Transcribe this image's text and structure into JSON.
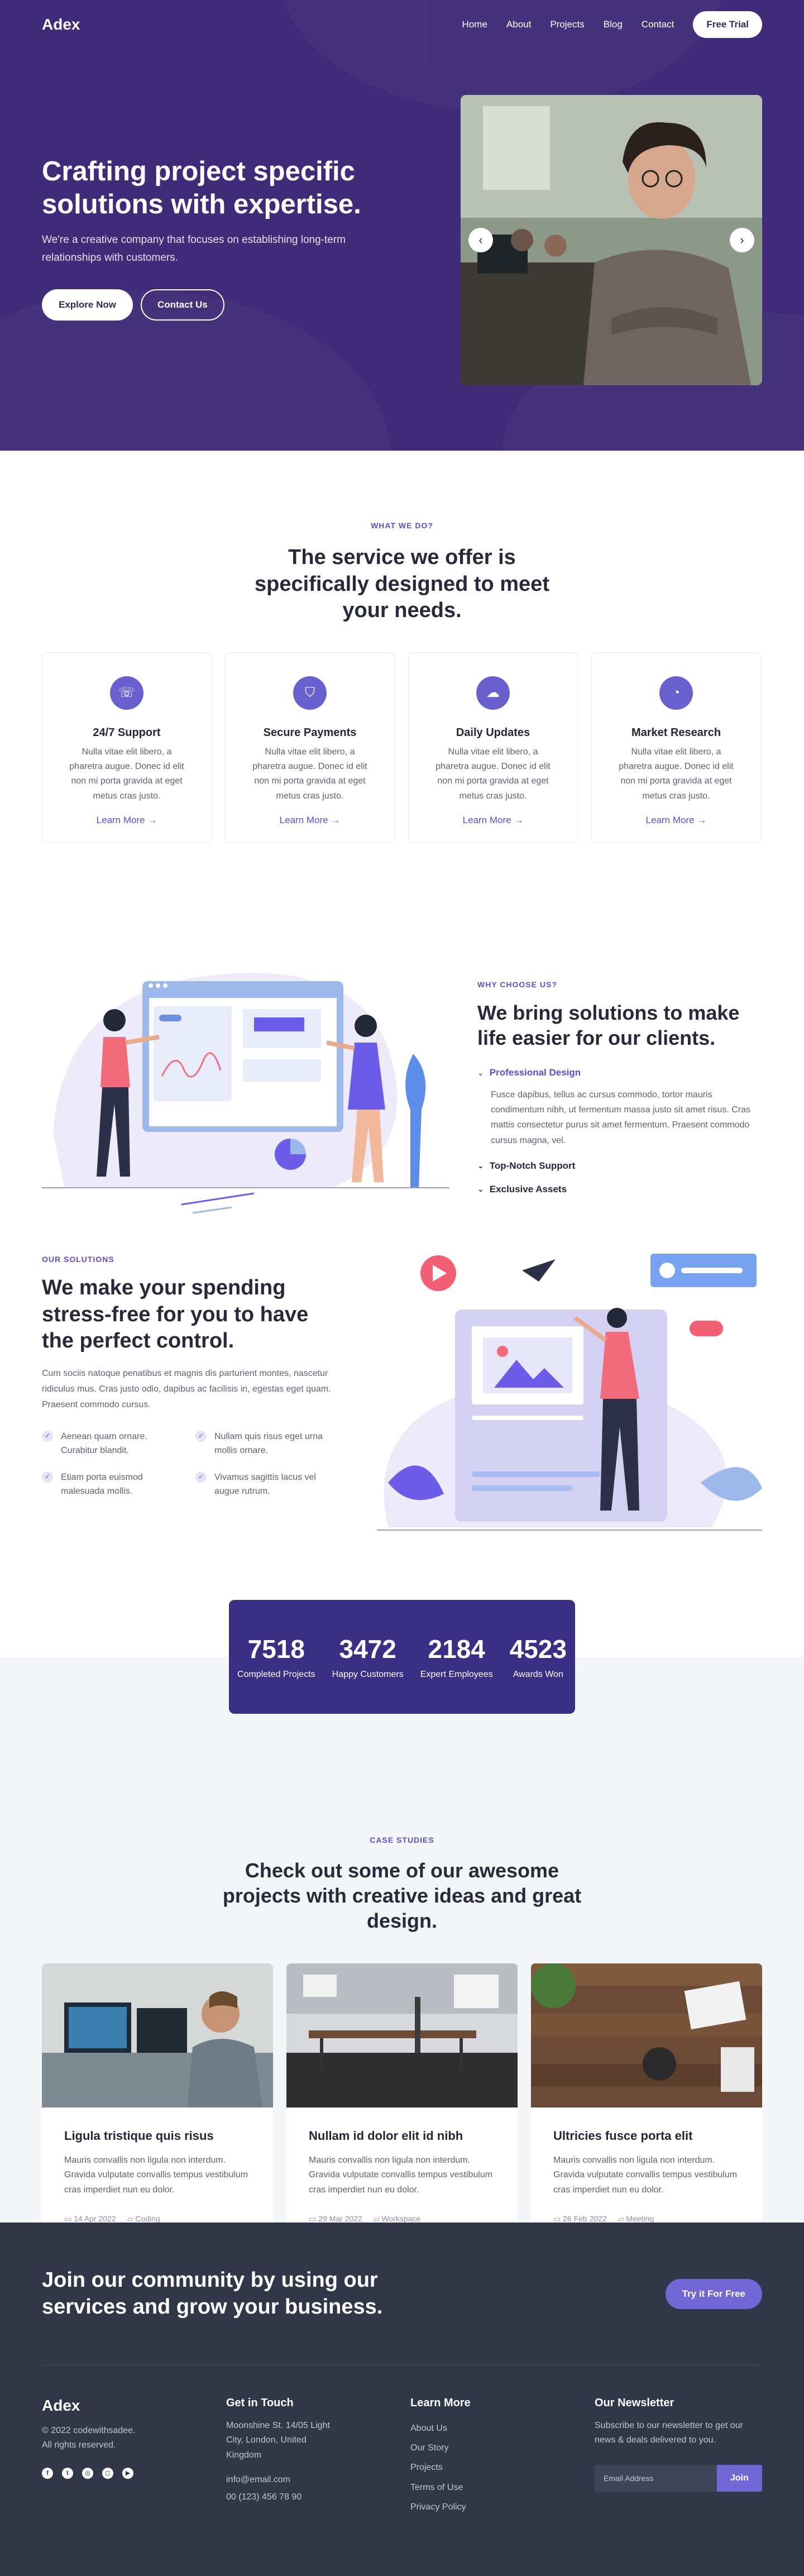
{
  "nav": {
    "logo": "Adex",
    "links": [
      "Home",
      "About",
      "Projects",
      "Blog",
      "Contact"
    ],
    "cta": "Free Trial"
  },
  "hero": {
    "title": "Crafting project specific solutions with expertise.",
    "subtitle": "We're a creative company that focuses on establishing long-term relationships with customers.",
    "primary_button": "Explore Now",
    "secondary_button": "Contact Us",
    "prev_icon": "chevron-left-icon",
    "next_icon": "chevron-right-icon"
  },
  "services": {
    "eyebrow": "WHAT WE DO?",
    "title": "The service we offer is specifically designed to meet your needs.",
    "items": [
      {
        "icon": "phone-icon",
        "title": "24/7 Support",
        "text": "Nulla vitae elit libero, a pharetra augue. Donec id elit non mi porta gravida at eget metus cras justo.",
        "link": "Learn More →"
      },
      {
        "icon": "shield-icon",
        "title": "Secure Payments",
        "text": "Nulla vitae elit libero, a pharetra augue. Donec id elit non mi porta gravida at eget metus cras justo.",
        "link": "Learn More →"
      },
      {
        "icon": "cloud-download-icon",
        "title": "Daily Updates",
        "text": "Nulla vitae elit libero, a pharetra augue. Donec id elit non mi porta gravida at eget metus cras justo.",
        "link": "Learn More →"
      },
      {
        "icon": "chart-pie-icon",
        "title": "Market Research",
        "text": "Nulla vitae elit libero, a pharetra augue. Donec id elit non mi porta gravida at eget metus cras justo.",
        "link": "Learn More →"
      }
    ]
  },
  "why": {
    "eyebrow": "WHY CHOOSE US?",
    "title": "We bring solutions to make life easier for our clients.",
    "accordion": [
      {
        "title": "Professional Design",
        "open": true,
        "body": "Fusce dapibus, tellus ac cursus commodo, tortor mauris condimentum nibh, ut fermentum massa justo sit amet risus. Cras mattis consectetur purus sit amet fermentum. Praesent commodo cursus magna, vel."
      },
      {
        "title": "Top-Notch Support",
        "open": false
      },
      {
        "title": "Exclusive Assets",
        "open": false
      }
    ]
  },
  "solutions": {
    "eyebrow": "OUR SOLUTIONS",
    "title": "We make your spending stress-free for you to have the perfect control.",
    "description": "Cum sociis natoque penatibus et magnis dis parturient montes, nascetur ridiculus mus. Cras justo odio, dapibus ac facilisis in, egestas eget quam. Praesent commodo cursus.",
    "checks": [
      "Aenean quam ornare. Curabitur blandit.",
      "Nullam quis risus eget urna mollis ornare.",
      "Etiam porta euismod malesuada mollis.",
      "Vivamus sagittis lacus vel augue rutrum."
    ]
  },
  "stats": [
    {
      "value": "7518",
      "label": "Completed Projects"
    },
    {
      "value": "3472",
      "label": "Happy Customers"
    },
    {
      "value": "2184",
      "label": "Expert Employees"
    },
    {
      "value": "4523",
      "label": "Awards Won"
    }
  ],
  "projects": {
    "eyebrow": "CASE STUDIES",
    "title": "Check out some of our awesome projects with creative ideas and great design.",
    "items": [
      {
        "title": "Ligula tristique quis risus",
        "text": "Mauris convallis non ligula non interdum. Gravida vulputate convallis tempus vestibulum cras imperdiet nun eu dolor.",
        "date": "14 Apr 2022",
        "tag": "Coding"
      },
      {
        "title": "Nullam id dolor elit id nibh",
        "text": "Mauris convallis non ligula non interdum. Gravida vulputate convallis tempus vestibulum cras imperdiet nun eu dolor.",
        "date": "29 Mar 2022",
        "tag": "Workspace"
      },
      {
        "title": "Ultricies fusce porta elit",
        "text": "Mauris convallis non ligula non interdum. Gravida vulputate convallis tempus vestibulum cras imperdiet nun eu dolor.",
        "date": "26 Feb 2022",
        "tag": "Meeting"
      }
    ]
  },
  "footer": {
    "cta_title": "Join our community by using our services and grow your business.",
    "cta_button": "Try it For Free",
    "logo": "Adex",
    "copyright": "© 2022 codewithsadee.\nAll rights reserved.",
    "social_icons": [
      "facebook-icon",
      "twitter-icon",
      "dribbble-icon",
      "instagram-icon",
      "youtube-icon"
    ],
    "contact_title": "Get in Touch",
    "address": "Moonshine St. 14/05 Light City, London, United Kingdom",
    "email": "info@email.com",
    "phone": "00 (123) 456 78 90",
    "learn_title": "Learn More",
    "learn_links": [
      "About Us",
      "Our Story",
      "Projects",
      "Terms of Use",
      "Privacy Policy"
    ],
    "newsletter_title": "Our Newsletter",
    "newsletter_text": "Subscribe to our newsletter to get our news & deals delivered to you.",
    "newsletter_placeholder": "Email Address",
    "newsletter_button": "Join"
  }
}
